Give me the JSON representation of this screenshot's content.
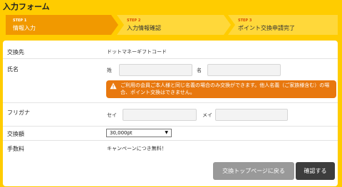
{
  "page_title": "入力フォーム",
  "steps": [
    {
      "no": "STEP 1",
      "label": "情報入力"
    },
    {
      "no": "STEP 2",
      "label": "入力情報確認"
    },
    {
      "no": "STEP 3",
      "label": "ポイント交換申請完了"
    }
  ],
  "colors": {
    "background": "#ffcc00",
    "step_active": "#f19900",
    "step_inactive": "#ffd83a",
    "alert": "#e8780f",
    "button_back": "#999999",
    "button_confirm": "#3d3d3d"
  },
  "form": {
    "exchange_dest": {
      "label": "交換先",
      "value": "ドットマネーギフトコード"
    },
    "name": {
      "label": "氏名",
      "last_label": "姓",
      "last_value": "",
      "first_label": "名",
      "first_value": "",
      "alert_icon": "warning-icon",
      "alert": "ご利用の会員ご本人様と同じ名義の場合のみ交換ができます。他人名義（ご家族様含む）の場合、ポイント交換はできません。"
    },
    "kana": {
      "label": "フリガナ",
      "last_label": "セイ",
      "last_value": "",
      "first_label": "メイ",
      "first_value": ""
    },
    "amount": {
      "label": "交換額",
      "selected": "30,000pt"
    },
    "fee": {
      "label": "手数料",
      "value": "キャンペーンにつき無料！"
    }
  },
  "buttons": {
    "back": "交換トップページに戻る",
    "confirm": "確認する"
  }
}
